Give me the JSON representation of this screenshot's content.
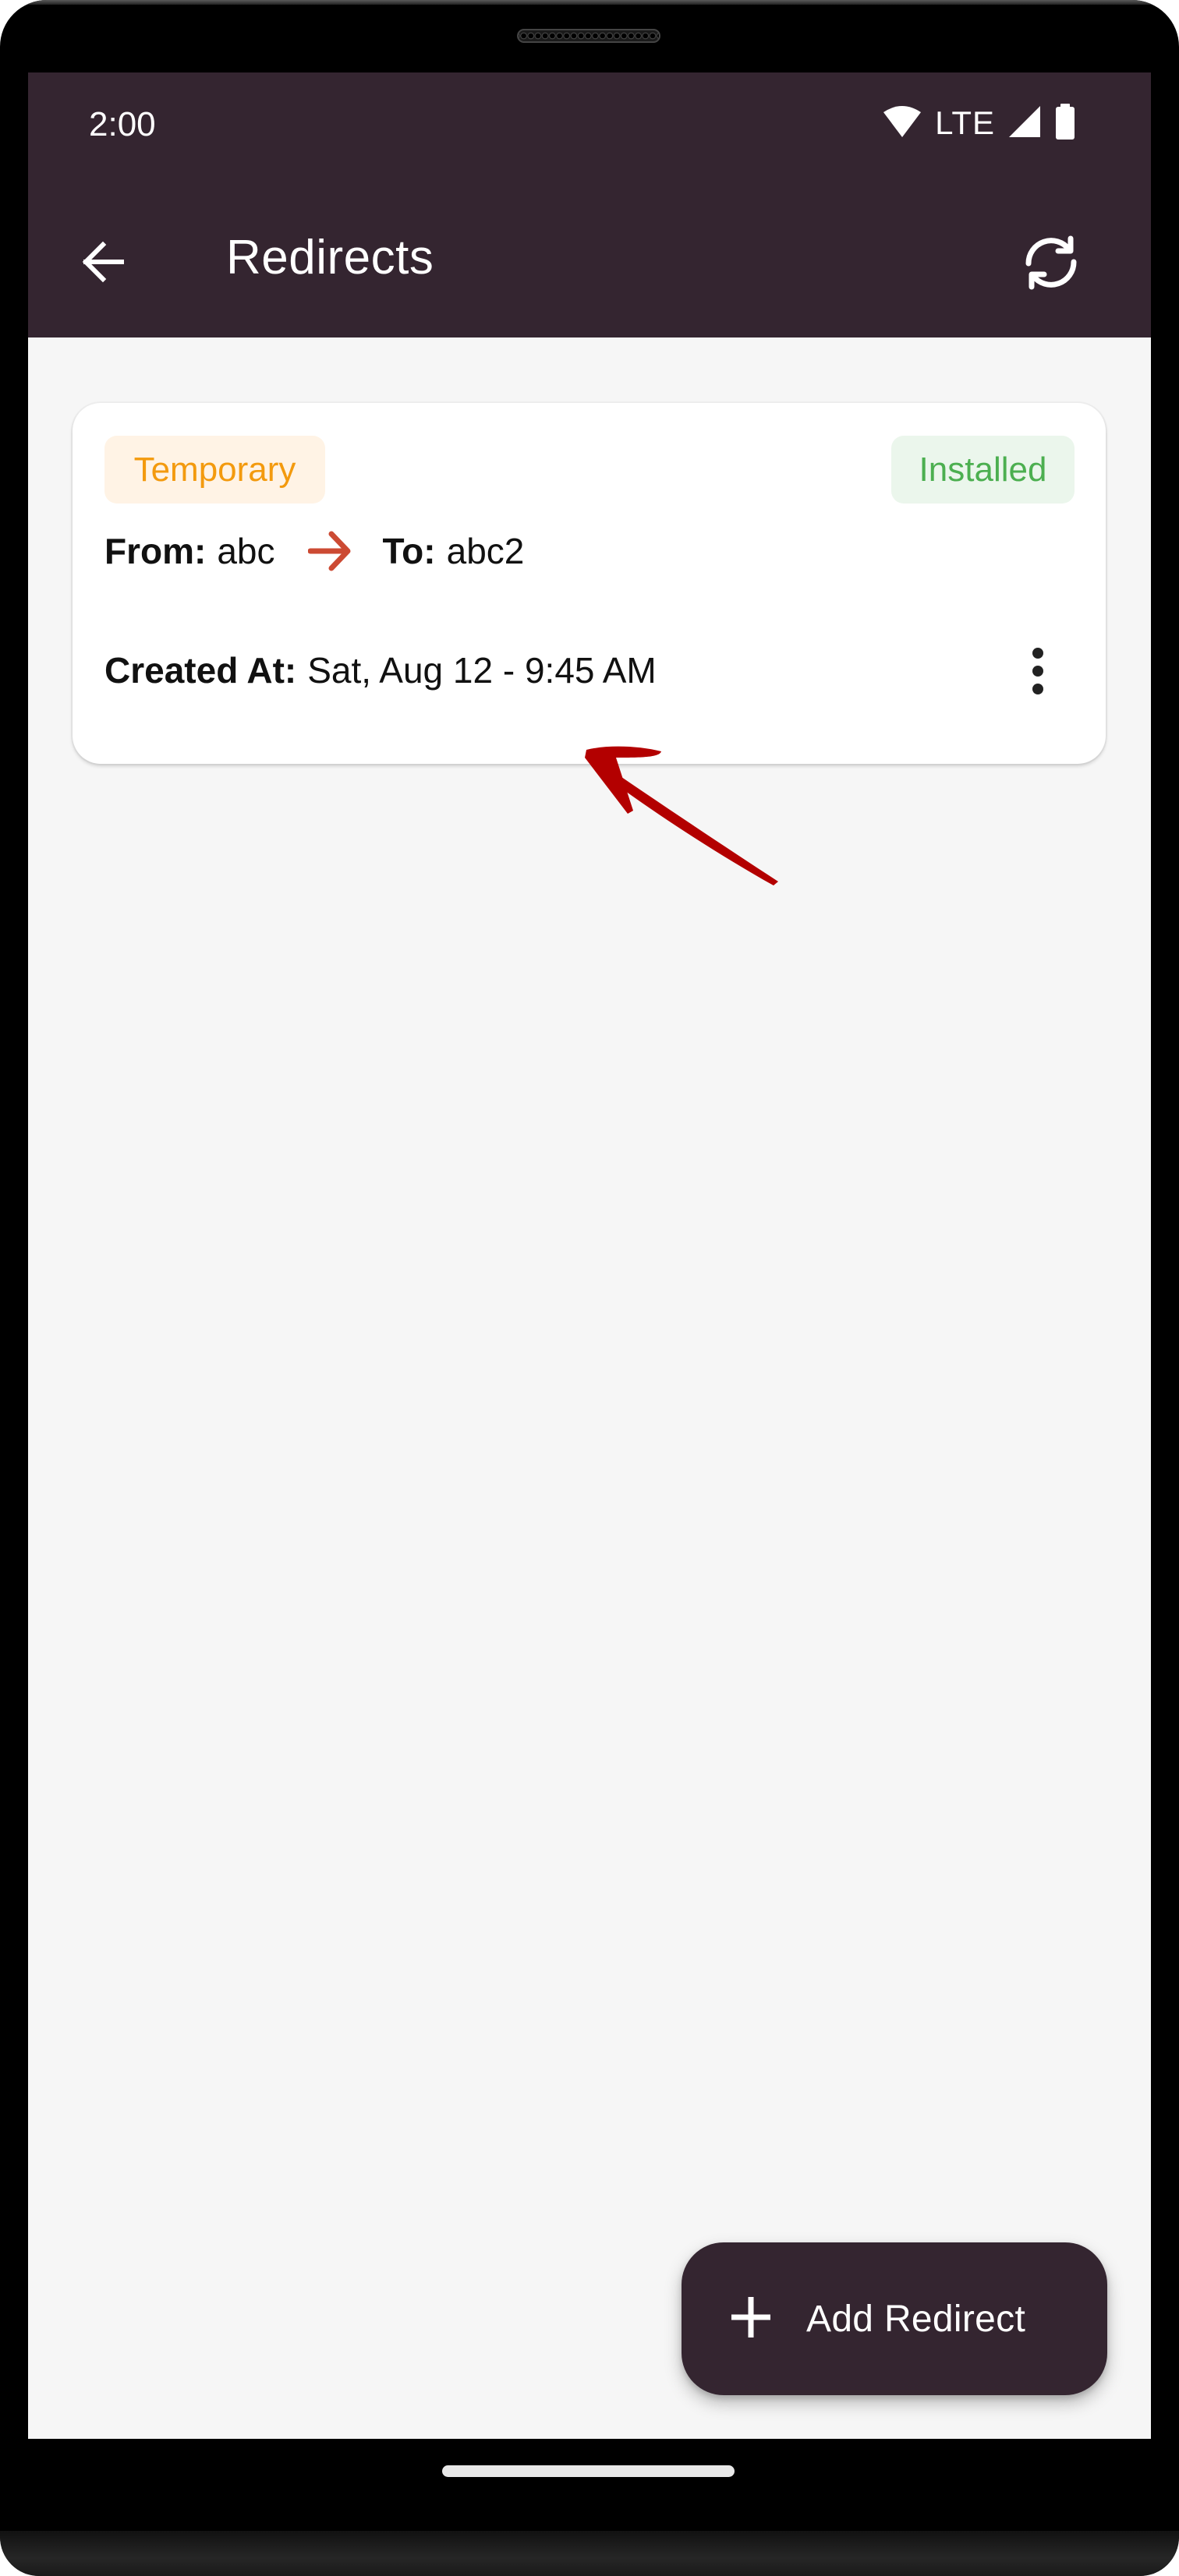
{
  "status_bar": {
    "time": "2:00",
    "network": "LTE",
    "icons": [
      "wifi-icon",
      "signal-icon",
      "battery-icon"
    ]
  },
  "app_bar": {
    "title": "Redirects",
    "back_icon": "arrow-back-icon",
    "refresh_icon": "refresh-icon"
  },
  "redirects": [
    {
      "type_badge": "Temporary",
      "status_badge": "Installed",
      "from_label": "From:",
      "from_value": "abc",
      "to_label": "To:",
      "to_value": "abc2",
      "created_label": "Created At:",
      "created_value": "Sat, Aug 12 - 9:45 AM",
      "menu_icon": "more-vertical-icon"
    }
  ],
  "fab": {
    "label": "Add Redirect",
    "icon": "plus-icon"
  },
  "colors": {
    "app_bar": "#342530",
    "background": "#f6f6f6",
    "temporary_text": "#f39a0e",
    "temporary_bg": "#fff3e5",
    "installed_text": "#4caf50",
    "installed_bg": "#ebf6ec",
    "redirect_arrow": "#cc4a33",
    "annotation_arrow": "#b30000"
  }
}
